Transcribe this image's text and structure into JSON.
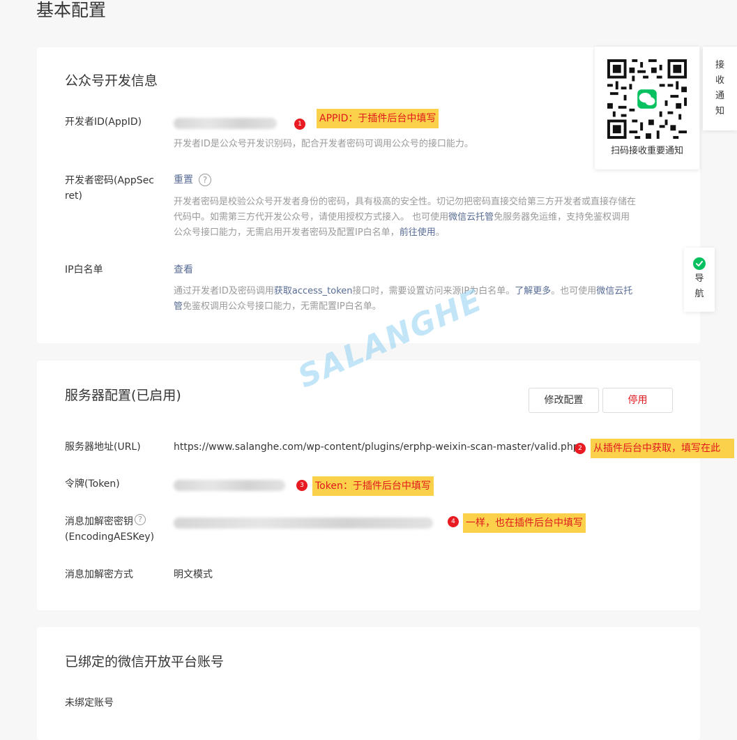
{
  "page_title": "基本配置",
  "dev_info": {
    "title": "公众号开发信息",
    "appid_label": "开发者ID(AppID)",
    "appid_desc": "开发者ID是公众号开发识别码，配合开发者密码可调用公众号的接口能力。",
    "secret_label_1": "开发者密码(AppSec",
    "secret_label_2": "ret)",
    "secret_reset": "重置",
    "secret_desc_1": "开发者密码是校验公众号开发者身份的密码，具有极高的安全性。切记勿把密码直接交给第三方开发者或直接存储在",
    "secret_desc_2": "代码中。如需第三方代开发公众号，请使用授权方式接入。 也可使用",
    "secret_desc_link1": "微信云托管",
    "secret_desc_3": "免服务器免运维，支持免鉴权调用",
    "secret_desc_4": "公众号接口能力，无需启用开发者密码及配置IP白名单，",
    "secret_desc_link2": "前往使用",
    "secret_desc_end": "。",
    "ip_label": "IP白名单",
    "ip_view": "查看",
    "ip_desc_1a": "通过开发者ID及密码调用",
    "ip_desc_link1": "获取access_token",
    "ip_desc_1b": "接口时，需要设置访问来源IP为白名单。",
    "ip_desc_link2": "了解更多",
    "ip_desc_1c": "。也可使用",
    "ip_desc_link3a": "微信云托",
    "ip_desc_link3b": "管",
    "ip_desc_2": "免鉴权调用公众号接口能力，无需配置IP白名单。"
  },
  "server": {
    "title": "服务器配置(已启用)",
    "modify_button": "修改配置",
    "disable_button": "停用",
    "url_label": "服务器地址(URL)",
    "url_value": "https://www.salanghe.com/wp-content/plugins/erphp-weixin-scan-master/valid.php",
    "token_label": "令牌(Token)",
    "aes_label_1": "消息加解密密钥",
    "aes_label_2": "(EncodingAESKey)",
    "mode_label": "消息加解密方式",
    "mode_value": "明文模式"
  },
  "bound": {
    "title": "已绑定的微信开放平台账号",
    "none": "未绑定账号"
  },
  "annotations": {
    "a1_num": "1",
    "a1_text": "APPID：于插件后台中填写",
    "a2_num": "2",
    "a2_text": "从插件后台中获取，填写在此",
    "a3_num": "3",
    "a3_text": "Token：于插件后台中填写",
    "a4_num": "4",
    "a4_text": "一样，也在插件后台中填写"
  },
  "qr_panel": {
    "caption": "扫码接收重要通知"
  },
  "side": {
    "notify": [
      "接",
      "收",
      "通",
      "知"
    ],
    "nav": [
      "导",
      "航"
    ]
  },
  "watermark": "SALANGHE",
  "colors": {
    "link": "#576b95",
    "annot_bg": "#fbd14b",
    "annot_text": "#e0181b",
    "badge": "#e81b23",
    "danger": "#e0181b",
    "wechat_green": "#07c160"
  },
  "icons": {
    "help": "question-circle-icon",
    "nav": "wechat-check-icon",
    "qr": "qr-code-icon"
  }
}
